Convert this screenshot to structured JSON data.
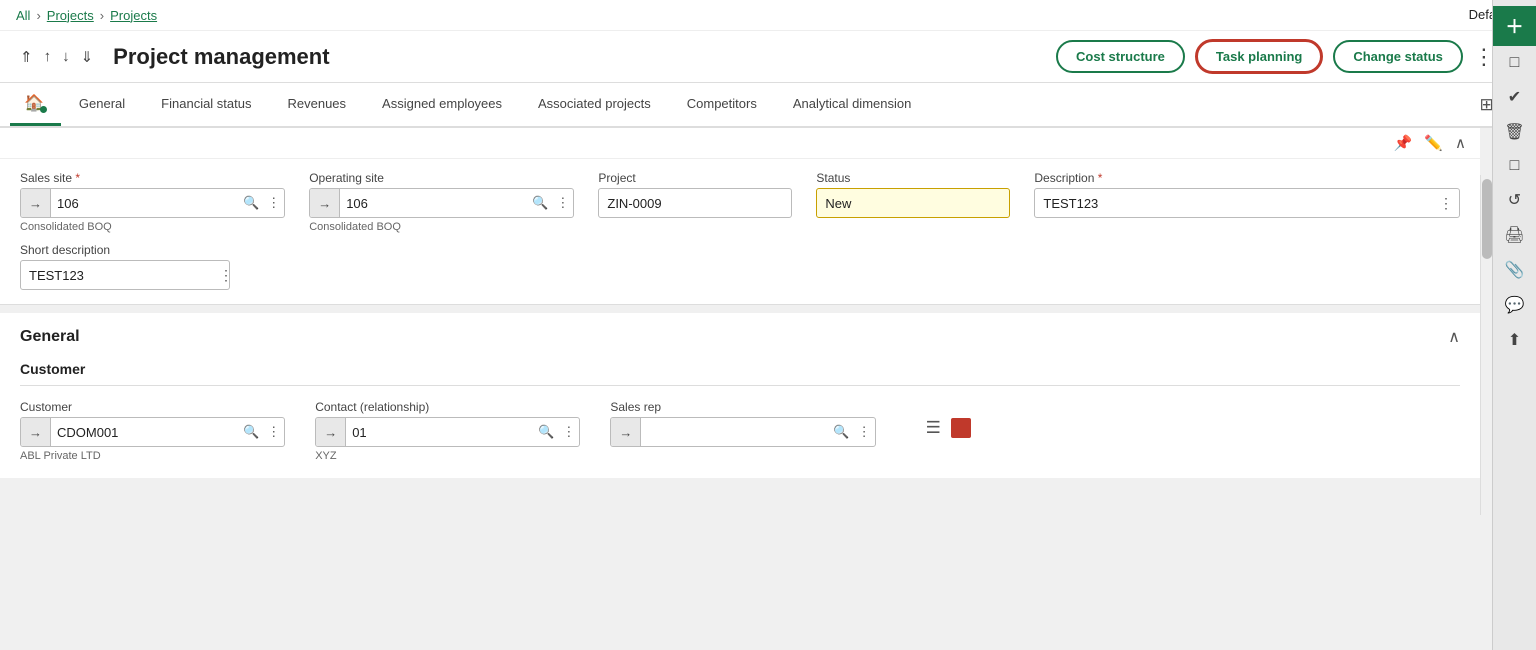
{
  "breadcrumb": {
    "all": "All",
    "projects1": "Projects",
    "projects2": "Projects"
  },
  "header": {
    "title": "Project management",
    "nav_arrows": [
      "↑↑",
      "↑",
      "↓",
      "↓↓"
    ],
    "cost_structure": "Cost structure",
    "task_planning": "Task planning",
    "change_status": "Change status"
  },
  "tabs": {
    "home_icon": "🏠",
    "items": [
      "General",
      "Financial status",
      "Revenues",
      "Assigned employees",
      "Associated projects",
      "Competitors",
      "Analytical dimension"
    ]
  },
  "form": {
    "sales_site_label": "Sales site",
    "sales_site_value": "106",
    "sales_site_sub": "Consolidated BOQ",
    "operating_site_label": "Operating site",
    "operating_site_value": "106",
    "operating_site_sub": "Consolidated BOQ",
    "project_label": "Project",
    "project_value": "ZIN-0009",
    "status_label": "Status",
    "status_value": "New",
    "description_label": "Description",
    "description_value": "TEST123",
    "short_desc_label": "Short description",
    "short_desc_value": "TEST123"
  },
  "general": {
    "title": "General",
    "customer_section": "Customer",
    "customer_label": "Customer",
    "customer_value": "CDOM001",
    "customer_sub": "ABL Private LTD",
    "contact_label": "Contact (relationship)",
    "contact_value": "01",
    "contact_sub": "XYZ",
    "sales_rep_label": "Sales rep",
    "sales_rep_value": ""
  },
  "top_right": "Default",
  "sidebar_icons": [
    "＋",
    "□",
    "✔",
    "🗑",
    "□",
    "↺",
    "🖨",
    "📎",
    "💬",
    "⬆"
  ]
}
